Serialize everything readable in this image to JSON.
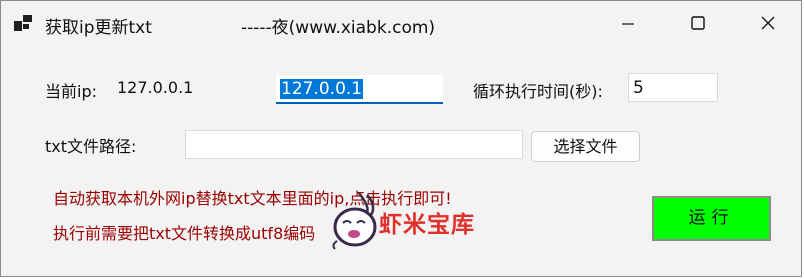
{
  "window": {
    "title": "获取ip更新txt",
    "subtitle": "-----夜(www.xiabk.com)"
  },
  "form": {
    "current_ip_label": "当前ip:",
    "current_ip_value": "127.0.0.1",
    "ip_input_value": "127.0.0.1",
    "interval_label": "循环执行时间(秒):",
    "interval_value": "5",
    "path_label": "txt文件路径:",
    "path_value": "",
    "choose_file_label": "选择文件"
  },
  "notes": {
    "line1": "自动获取本机外网ip替换txt文本里面的ip,点击执行即可!",
    "line2": "执行前需要把txt文件转换成utf8编码"
  },
  "run_button_label": "运行",
  "watermark_text": "虾米宝库",
  "colors": {
    "note_text": "#9b0000",
    "run_button_bg": "#00ff00",
    "selection": "#0078d7",
    "focus_underline": "#005fb8",
    "watermark": "#e0302a"
  },
  "icons": {
    "app": "app-window-icon",
    "minimize": "minimize-icon",
    "maximize": "maximize-icon",
    "close": "close-icon"
  }
}
